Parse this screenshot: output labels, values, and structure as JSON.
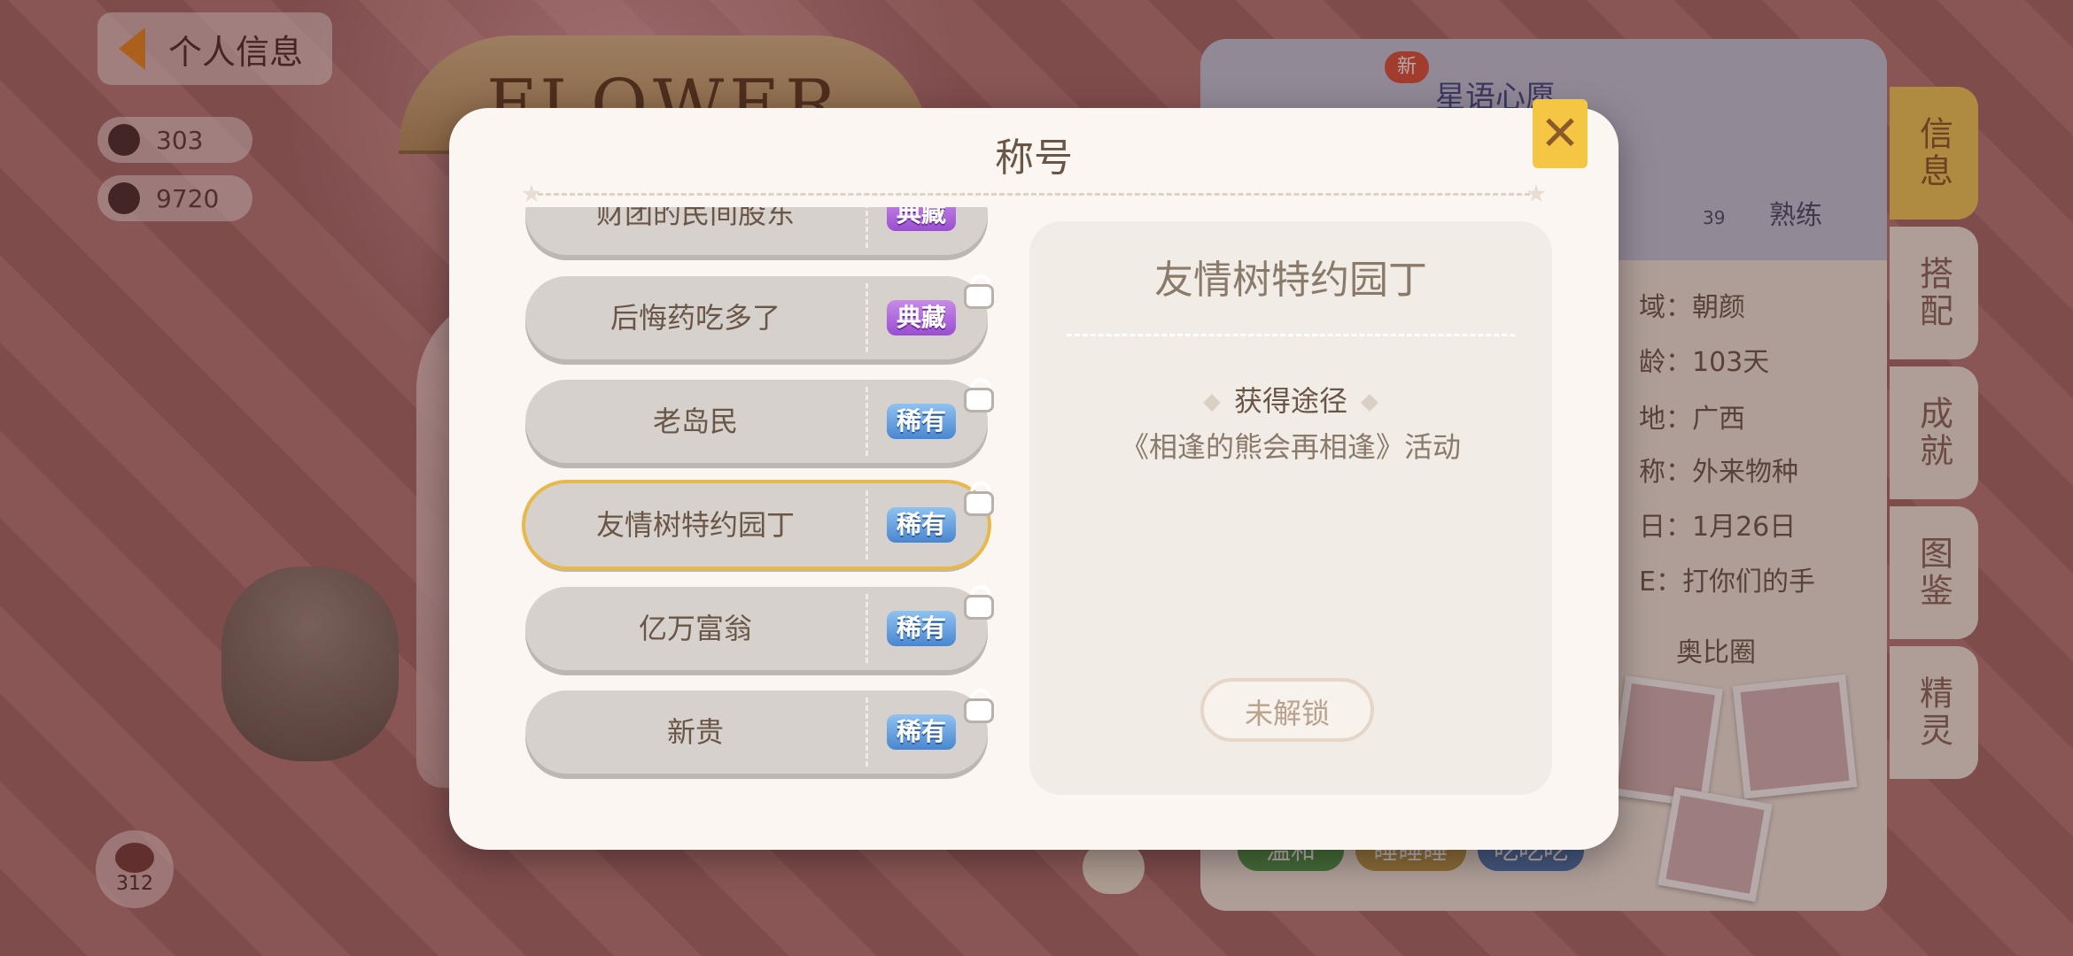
{
  "background": {
    "banner_text": "FLOWER",
    "back_button_label": "个人信息",
    "stats": [
      "303",
      "9720"
    ],
    "bottom_badge_count": "312"
  },
  "profile_card": {
    "new_badge": "新",
    "nickname": "星语心愿",
    "skill_level": "熟练",
    "skill_level_number": "39",
    "rows": [
      "域：朝颜",
      "龄：103天",
      "地：广西",
      "称：外来物种",
      "日：1月26日",
      "E：打你们的手"
    ],
    "circle_label": "奥比圈",
    "tags": [
      "温和",
      "睡睡睡",
      "吃吃吃"
    ],
    "side_tabs": [
      "信息",
      "搭配",
      "成就",
      "图鉴",
      "精灵"
    ],
    "active_tab": "信息"
  },
  "modal": {
    "title": "称号",
    "close_icon": "close-x-icon",
    "titles": [
      {
        "name": "财团的民间股东",
        "rarity": "典藏",
        "rarity_color": "#9a4ed0",
        "locked": true
      },
      {
        "name": "后悔药吃多了",
        "rarity": "典藏",
        "rarity_color": "#9a4ed0",
        "locked": true
      },
      {
        "name": "老岛民",
        "rarity": "稀有",
        "rarity_color": "#4a86d0",
        "locked": true
      },
      {
        "name": "友情树特约园丁",
        "rarity": "稀有",
        "rarity_color": "#4a86d0",
        "locked": true,
        "selected": true
      },
      {
        "name": "亿万富翁",
        "rarity": "稀有",
        "rarity_color": "#4a86d0",
        "locked": true
      },
      {
        "name": "新贵",
        "rarity": "稀有",
        "rarity_color": "#4a86d0",
        "locked": true
      }
    ],
    "detail": {
      "title": "友情树特约园丁",
      "acquire_label": "获得途径",
      "acquire_value": "《相逢的熊会再相逢》活动",
      "unlock_button": "未解锁"
    }
  },
  "colors": {
    "selected_outline": "#e9b84a",
    "close_button": "#f5c544",
    "active_side_tab": "#f5cf5a"
  }
}
